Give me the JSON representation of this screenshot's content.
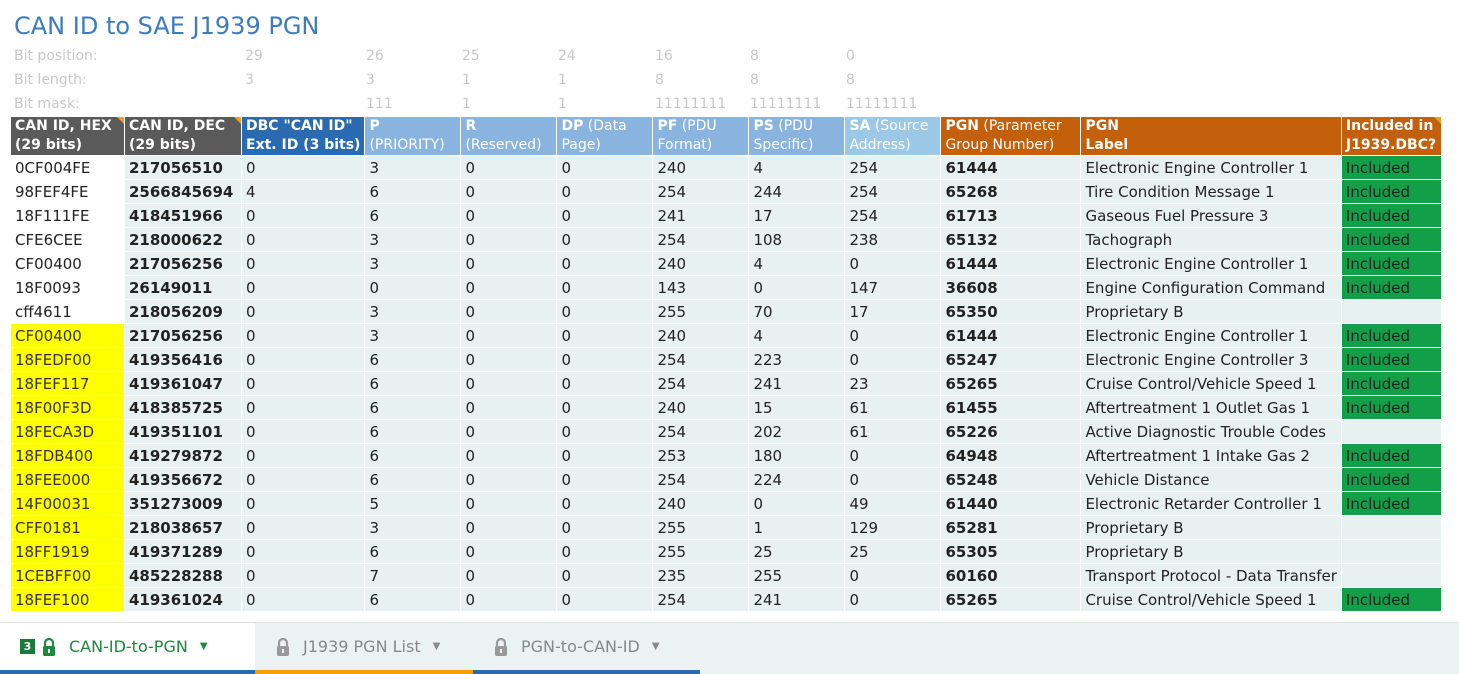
{
  "title": "CAN ID to SAE J1939 PGN",
  "meta": {
    "bit_position": {
      "label": "Bit position:",
      "values": [
        "29",
        "26",
        "25",
        "24",
        "16",
        "8",
        "0"
      ]
    },
    "bit_length": {
      "label": "Bit length:",
      "values": [
        "3",
        "3",
        "1",
        "1",
        "8",
        "8",
        "8"
      ]
    },
    "bit_mask": {
      "label": "Bit mask:",
      "values": [
        "",
        "111",
        "1",
        "1",
        "11111111",
        "11111111",
        "11111111"
      ]
    }
  },
  "columns": [
    {
      "bold": "CAN ID, HEX",
      "rest": "(29 bits)"
    },
    {
      "bold": "CAN ID, DEC",
      "rest": "(29 bits)"
    },
    {
      "bold": "DBC \"CAN ID\"",
      "rest": "Ext. ID (3 bits)"
    },
    {
      "bold": "P",
      "rest": "(PRIORITY)"
    },
    {
      "bold": "R",
      "rest": "(Reserved)"
    },
    {
      "bold": "DP",
      "rest": " (Data Page)"
    },
    {
      "bold": "PF",
      "rest": " (PDU Format)"
    },
    {
      "bold": "PS",
      "rest": " (PDU Specific)"
    },
    {
      "bold": "SA",
      "rest": " (Source Address)"
    },
    {
      "bold": "PGN",
      "rest": " (Parameter Group Number)"
    },
    {
      "bold": "PGN",
      "rest": "Label"
    },
    {
      "bold": "Included in",
      "rest": "J1939.DBC?"
    }
  ],
  "rows": [
    {
      "hex": "0CF004FE",
      "dec": "217056510",
      "ext": "0",
      "p": "3",
      "r": "0",
      "dp": "0",
      "pf": "240",
      "ps": "4",
      "sa": "254",
      "pgn": "61444",
      "label": "Electronic Engine Controller 1",
      "inc": "Included",
      "hl": false
    },
    {
      "hex": "98FEF4FE",
      "dec": "2566845694",
      "ext": "4",
      "p": "6",
      "r": "0",
      "dp": "0",
      "pf": "254",
      "ps": "244",
      "sa": "254",
      "pgn": "65268",
      "label": "Tire Condition Message 1",
      "inc": "Included",
      "hl": false
    },
    {
      "hex": "18F111FE",
      "dec": "418451966",
      "ext": "0",
      "p": "6",
      "r": "0",
      "dp": "0",
      "pf": "241",
      "ps": "17",
      "sa": "254",
      "pgn": "61713",
      "label": "Gaseous Fuel Pressure 3",
      "inc": "Included",
      "hl": false
    },
    {
      "hex": "CFE6CEE",
      "dec": "218000622",
      "ext": "0",
      "p": "3",
      "r": "0",
      "dp": "0",
      "pf": "254",
      "ps": "108",
      "sa": "238",
      "pgn": "65132",
      "label": "Tachograph",
      "inc": "Included",
      "hl": false
    },
    {
      "hex": "CF00400",
      "dec": "217056256",
      "ext": "0",
      "p": "3",
      "r": "0",
      "dp": "0",
      "pf": "240",
      "ps": "4",
      "sa": "0",
      "pgn": "61444",
      "label": "Electronic Engine Controller 1",
      "inc": "Included",
      "hl": false
    },
    {
      "hex": "18F0093",
      "dec": "26149011",
      "ext": "0",
      "p": "0",
      "r": "0",
      "dp": "0",
      "pf": "143",
      "ps": "0",
      "sa": "147",
      "pgn": "36608",
      "label": "Engine Configuration Command",
      "inc": "Included",
      "hl": false
    },
    {
      "hex": "cff4611",
      "dec": "218056209",
      "ext": "0",
      "p": "3",
      "r": "0",
      "dp": "0",
      "pf": "255",
      "ps": "70",
      "sa": "17",
      "pgn": "65350",
      "label": "Proprietary B",
      "inc": "",
      "hl": false
    },
    {
      "hex": "CF00400",
      "dec": "217056256",
      "ext": "0",
      "p": "3",
      "r": "0",
      "dp": "0",
      "pf": "240",
      "ps": "4",
      "sa": "0",
      "pgn": "61444",
      "label": "Electronic Engine Controller 1",
      "inc": "Included",
      "hl": true
    },
    {
      "hex": "18FEDF00",
      "dec": "419356416",
      "ext": "0",
      "p": "6",
      "r": "0",
      "dp": "0",
      "pf": "254",
      "ps": "223",
      "sa": "0",
      "pgn": "65247",
      "label": "Electronic Engine Controller 3",
      "inc": "Included",
      "hl": true
    },
    {
      "hex": "18FEF117",
      "dec": "419361047",
      "ext": "0",
      "p": "6",
      "r": "0",
      "dp": "0",
      "pf": "254",
      "ps": "241",
      "sa": "23",
      "pgn": "65265",
      "label": "Cruise Control/Vehicle Speed 1",
      "inc": "Included",
      "hl": true
    },
    {
      "hex": "18F00F3D",
      "dec": "418385725",
      "ext": "0",
      "p": "6",
      "r": "0",
      "dp": "0",
      "pf": "240",
      "ps": "15",
      "sa": "61",
      "pgn": "61455",
      "label": "Aftertreatment 1 Outlet Gas 1",
      "inc": "Included",
      "hl": true
    },
    {
      "hex": "18FECA3D",
      "dec": "419351101",
      "ext": "0",
      "p": "6",
      "r": "0",
      "dp": "0",
      "pf": "254",
      "ps": "202",
      "sa": "61",
      "pgn": "65226",
      "label": "Active Diagnostic Trouble Codes",
      "inc": "",
      "hl": true
    },
    {
      "hex": "18FDB400",
      "dec": "419279872",
      "ext": "0",
      "p": "6",
      "r": "0",
      "dp": "0",
      "pf": "253",
      "ps": "180",
      "sa": "0",
      "pgn": "64948",
      "label": "Aftertreatment 1 Intake Gas 2",
      "inc": "Included",
      "hl": true
    },
    {
      "hex": "18FEE000",
      "dec": "419356672",
      "ext": "0",
      "p": "6",
      "r": "0",
      "dp": "0",
      "pf": "254",
      "ps": "224",
      "sa": "0",
      "pgn": "65248",
      "label": "Vehicle Distance",
      "inc": "Included",
      "hl": true
    },
    {
      "hex": "14F00031",
      "dec": "351273009",
      "ext": "0",
      "p": "5",
      "r": "0",
      "dp": "0",
      "pf": "240",
      "ps": "0",
      "sa": "49",
      "pgn": "61440",
      "label": "Electronic Retarder Controller 1",
      "inc": "Included",
      "hl": true
    },
    {
      "hex": "CFF0181",
      "dec": "218038657",
      "ext": "0",
      "p": "3",
      "r": "0",
      "dp": "0",
      "pf": "255",
      "ps": "1",
      "sa": "129",
      "pgn": "65281",
      "label": "Proprietary B",
      "inc": "",
      "hl": true
    },
    {
      "hex": "18FF1919",
      "dec": "419371289",
      "ext": "0",
      "p": "6",
      "r": "0",
      "dp": "0",
      "pf": "255",
      "ps": "25",
      "sa": "25",
      "pgn": "65305",
      "label": "Proprietary B",
      "inc": "",
      "hl": true
    },
    {
      "hex": "1CEBFF00",
      "dec": "485228288",
      "ext": "0",
      "p": "7",
      "r": "0",
      "dp": "0",
      "pf": "235",
      "ps": "255",
      "sa": "0",
      "pgn": "60160",
      "label": "Transport Protocol - Data Transfer",
      "inc": "",
      "hl": true
    },
    {
      "hex": "18FEF100",
      "dec": "419361024",
      "ext": "0",
      "p": "6",
      "r": "0",
      "dp": "0",
      "pf": "254",
      "ps": "241",
      "sa": "0",
      "pgn": "65265",
      "label": "Cruise Control/Vehicle Speed 1",
      "inc": "Included",
      "hl": true
    }
  ],
  "tabs": [
    {
      "label": "CAN-ID-to-PGN",
      "badge": "3",
      "active": true,
      "color": "#2a6ab0"
    },
    {
      "label": "J1939 PGN List",
      "active": false,
      "color": "#f5a000"
    },
    {
      "label": "PGN-to-CAN-ID",
      "active": false,
      "color": "#2a6ab0"
    }
  ],
  "colors": {
    "title": "#3d7bbd",
    "highlight": "#ffff00",
    "included": "#11a048",
    "header_orange": "#c45f0c"
  }
}
